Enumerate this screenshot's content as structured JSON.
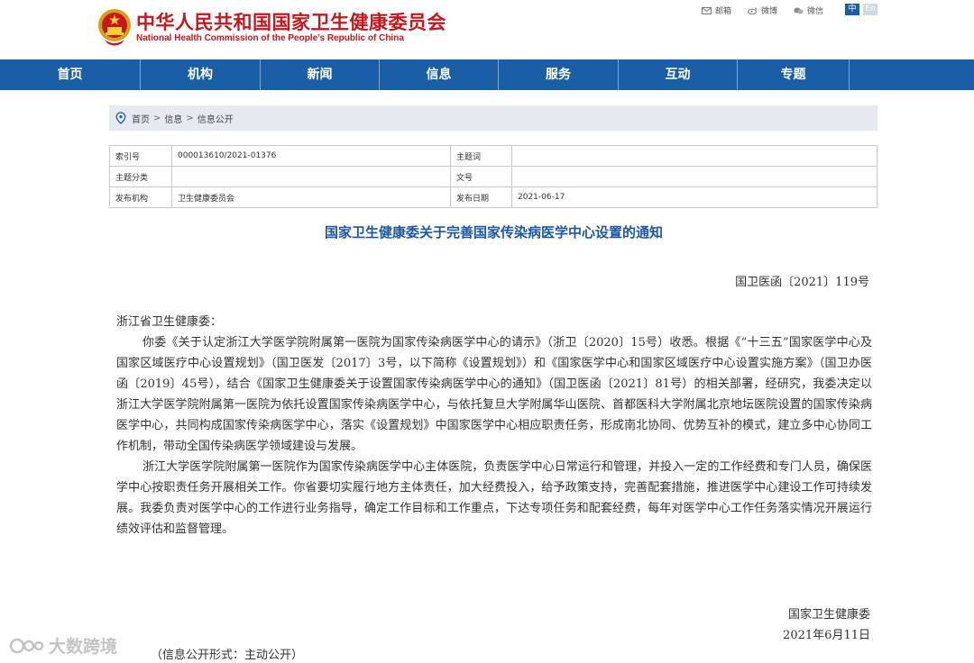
{
  "header": {
    "title_cn": "中华人民共和国国家卫生健康委员会",
    "title_en": "National Health Commission of the People’s Republic of China",
    "share": [
      {
        "label": "邮箱",
        "icon": "mail-icon"
      },
      {
        "label": "微博",
        "icon": "weibo-icon"
      },
      {
        "label": "微信",
        "icon": "wechat-icon"
      }
    ],
    "lang": {
      "zh": "中",
      "en": "En"
    }
  },
  "nav": [
    "首页",
    "机构",
    "新闻",
    "信息",
    "服务",
    "互动",
    "专题"
  ],
  "breadcrumb": [
    "首页",
    "信息",
    "信息公开"
  ],
  "meta": {
    "labels": {
      "index_no": "索引号",
      "subject_word": "主题词",
      "category": "主题分类",
      "doc_no": "文号",
      "publisher": "发布机构",
      "pub_date": "发布日期"
    },
    "values": {
      "index_no": "000013610/2021-01376",
      "subject_word": "",
      "category": "",
      "doc_no": "",
      "publisher": "卫生健康委员会",
      "pub_date": "2021-06-17"
    }
  },
  "document": {
    "title": "国家卫生健康委关于完善国家传染病医学中心设置的通知",
    "number": "国卫医函〔2021〕119号",
    "salutation": "浙江省卫生健康委：",
    "paragraphs": [
      "你委《关于认定浙江大学医学院附属第一医院为国家传染病医学中心的请示》（浙卫〔2020〕15号）收悉。根据《“十三五”国家医学中心及国家区域医疗中心设置规划》（国卫医发〔2017〕3号，以下简称《设置规划》）和《国家医学中心和国家区域医疗中心设置实施方案》（国卫办医函〔2019〕45号），结合《国家卫生健康委关于设置国家传染病医学中心的通知》（国卫医函〔2021〕81号）的相关部署，经研究，我委决定以浙江大学医学院附属第一医院为依托设置国家传染病医学中心，与依托复旦大学附属华山医院、首都医科大学附属北京地坛医院设置的国家传染病医学中心，共同构成国家传染病医学中心，落实《设置规划》中国家医学中心相应职责任务，形成南北协同、优势互补的模式，建立多中心协同工作机制，带动全国传染病医学领域建设与发展。",
      "浙江大学医学院附属第一医院作为国家传染病医学中心主体医院，负责医学中心日常运行和管理，并投入一定的工作经费和专门人员，确保医学中心按职责任务开展相关工作。你省要切实履行地方主体责任，加大经费投入，给予政策支持，完善配套措施，推进医学中心建设工作可持续发展。我委负责对医学中心的工作进行业务指导，确定工作目标和工作重点，下达专项任务和配套经费，每年对医学中心工作任务落实情况开展运行绩效评估和监督管理。"
    ],
    "signature": "国家卫生健康委",
    "date": "2021年6月11日",
    "disclosure": "（信息公开形式：主动公开）"
  },
  "watermark": "大数跨境",
  "colors": {
    "brand_red": "#c8161d",
    "nav_blue": "#1a5ea6",
    "title_blue": "#1d57a3"
  }
}
